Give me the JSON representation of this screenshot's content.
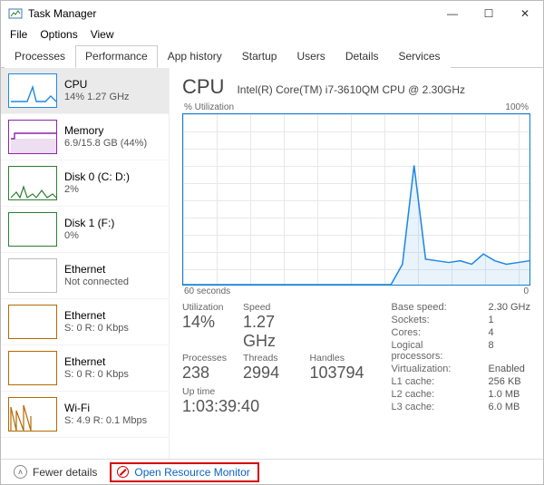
{
  "window": {
    "title": "Task Manager",
    "menu": {
      "file": "File",
      "options": "Options",
      "view": "View"
    },
    "controls": {
      "min": "—",
      "max": "☐",
      "close": "✕"
    }
  },
  "tabs": {
    "processes": "Processes",
    "performance": "Performance",
    "app_history": "App history",
    "startup": "Startup",
    "users": "Users",
    "details": "Details",
    "services": "Services"
  },
  "sidebar": [
    {
      "title": "CPU",
      "sub": "14% 1.27 GHz",
      "color": "#1e88e5",
      "kind": "cpu",
      "selected": true
    },
    {
      "title": "Memory",
      "sub": "6.9/15.8 GB (44%)",
      "color": "#8e24aa",
      "kind": "mem"
    },
    {
      "title": "Disk 0 (C: D:)",
      "sub": "2%",
      "color": "#2e7d32",
      "kind": "disk"
    },
    {
      "title": "Disk 1 (F:)",
      "sub": "0%",
      "color": "#2e7d32",
      "kind": "disk-empty"
    },
    {
      "title": "Ethernet",
      "sub": "Not connected",
      "color": "#bdbdbd",
      "kind": "net"
    },
    {
      "title": "Ethernet",
      "sub": "S: 0  R: 0 Kbps",
      "color": "#b26a00",
      "kind": "net"
    },
    {
      "title": "Ethernet",
      "sub": "S: 0  R: 0 Kbps",
      "color": "#b26a00",
      "kind": "net"
    },
    {
      "title": "Wi-Fi",
      "sub": "S: 4.9  R: 0.1 Mbps",
      "color": "#b26a00",
      "kind": "wifi"
    }
  ],
  "main": {
    "heading": "CPU",
    "model": "Intel(R) Core(TM) i7-3610QM CPU @ 2.30GHz",
    "util_label_left": "% Utilization",
    "util_label_right": "100%",
    "time_label_left": "60 seconds",
    "time_label_right": "0",
    "stats": {
      "utilization_label": "Utilization",
      "utilization": "14%",
      "speed_label": "Speed",
      "speed": "1.27 GHz",
      "processes_label": "Processes",
      "processes": "238",
      "threads_label": "Threads",
      "threads": "2994",
      "handles_label": "Handles",
      "handles": "103794",
      "uptime_label": "Up time",
      "uptime": "1:03:39:40"
    },
    "specs": {
      "base_speed_k": "Base speed:",
      "base_speed_v": "2.30 GHz",
      "sockets_k": "Sockets:",
      "sockets_v": "1",
      "cores_k": "Cores:",
      "cores_v": "4",
      "lprocs_k": "Logical processors:",
      "lprocs_v": "8",
      "virt_k": "Virtualization:",
      "virt_v": "Enabled",
      "l1_k": "L1 cache:",
      "l1_v": "256 KB",
      "l2_k": "L2 cache:",
      "l2_v": "1.0 MB",
      "l3_k": "L3 cache:",
      "l3_v": "6.0 MB"
    }
  },
  "footer": {
    "fewer": "Fewer details",
    "open_resource_monitor": "Open Resource Monitor"
  },
  "chart_data": {
    "type": "line",
    "title": "% Utilization",
    "xlabel": "seconds",
    "ylabel": "%",
    "xrange_seconds": [
      60,
      0
    ],
    "ylim": [
      0,
      100
    ],
    "x": [
      60,
      58,
      56,
      54,
      52,
      50,
      48,
      46,
      44,
      42,
      40,
      38,
      36,
      34,
      32,
      30,
      28,
      26,
      24,
      22,
      20,
      18,
      16,
      14,
      12,
      10,
      8,
      6,
      4,
      2,
      0
    ],
    "values": [
      0,
      0,
      0,
      0,
      0,
      0,
      0,
      0,
      0,
      0,
      0,
      0,
      0,
      0,
      0,
      0,
      0,
      0,
      0,
      12,
      70,
      15,
      14,
      13,
      14,
      12,
      18,
      14,
      12,
      13,
      14
    ]
  }
}
